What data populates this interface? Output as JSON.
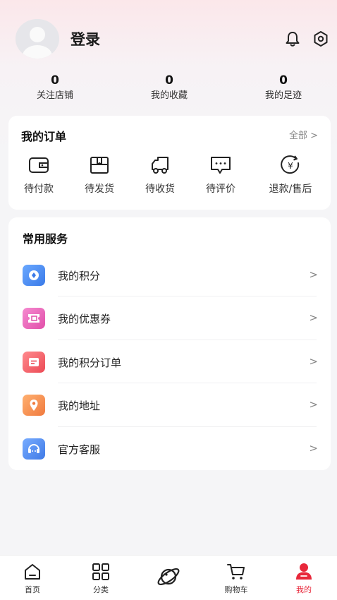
{
  "header": {
    "login_label": "登录"
  },
  "stats": [
    {
      "value": "0",
      "label": "关注店铺"
    },
    {
      "value": "0",
      "label": "我的收藏"
    },
    {
      "value": "0",
      "label": "我的足迹"
    }
  ],
  "orders": {
    "title": "我的订单",
    "all_label": "全部 >",
    "items": [
      {
        "label": "待付款",
        "icon": "wallet-icon"
      },
      {
        "label": "待发货",
        "icon": "package-icon"
      },
      {
        "label": "待收货",
        "icon": "truck-icon"
      },
      {
        "label": "待评价",
        "icon": "comment-icon"
      },
      {
        "label": "退款/售后",
        "icon": "refund-icon"
      }
    ]
  },
  "services": {
    "title": "常用服务",
    "items": [
      {
        "label": "我的积分",
        "icon": "points-icon",
        "color": "#4c8ff0"
      },
      {
        "label": "我的优惠券",
        "icon": "coupon-icon",
        "color": "#e95fb7"
      },
      {
        "label": "我的积分订单",
        "icon": "points-order-icon",
        "color": "#f05a63"
      },
      {
        "label": "我的地址",
        "icon": "location-icon",
        "color": "#f4924e"
      },
      {
        "label": "官方客服",
        "icon": "customer-service-icon",
        "color": "#4f8ff3"
      }
    ],
    "chevron": ">"
  },
  "tabbar": {
    "items": [
      {
        "label": "首页",
        "icon": "home-icon"
      },
      {
        "label": "分类",
        "icon": "category-icon"
      },
      {
        "label": "",
        "icon": "planet-icon"
      },
      {
        "label": "购物车",
        "icon": "cart-icon"
      },
      {
        "label": "我的",
        "icon": "profile-icon"
      }
    ],
    "active_index": 4,
    "accent": "#e8283b"
  }
}
